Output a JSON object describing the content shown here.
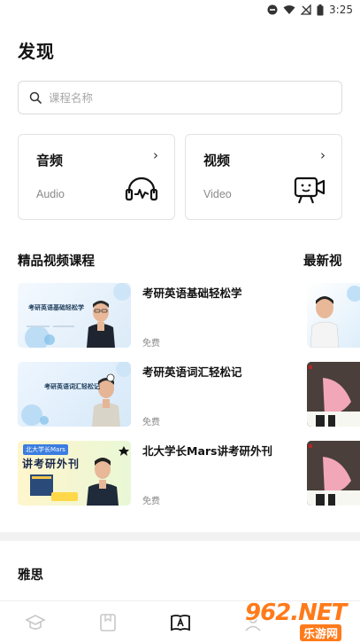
{
  "status": {
    "time": "3:25"
  },
  "page": {
    "title": "发现"
  },
  "search": {
    "placeholder": "课程名称"
  },
  "cards": {
    "audio": {
      "title": "音频",
      "subtitle": "Audio"
    },
    "video": {
      "title": "视频",
      "subtitle": "Video"
    }
  },
  "sections": {
    "featured": "精品视频课程",
    "latest": "最新视"
  },
  "courses": [
    {
      "title": "考研英语基础轻松学",
      "price": "免费",
      "thumb_text": "考研英语基础轻松学"
    },
    {
      "title": "考研英语词汇轻松记",
      "price": "免费",
      "thumb_text": "考研英语词汇轻松记"
    },
    {
      "title": "北大学长Mars讲考研外刊",
      "price": "免费",
      "thumb_text": "讲考研外刊",
      "thumb_top": "北大学长Mars"
    }
  ],
  "ielts": {
    "title": "雅思"
  },
  "watermark": {
    "main": "962.NET",
    "sub": "乐游网"
  },
  "colors": {
    "accent": "#ff7a1a",
    "thumb_bg": "#e8f2fb"
  }
}
